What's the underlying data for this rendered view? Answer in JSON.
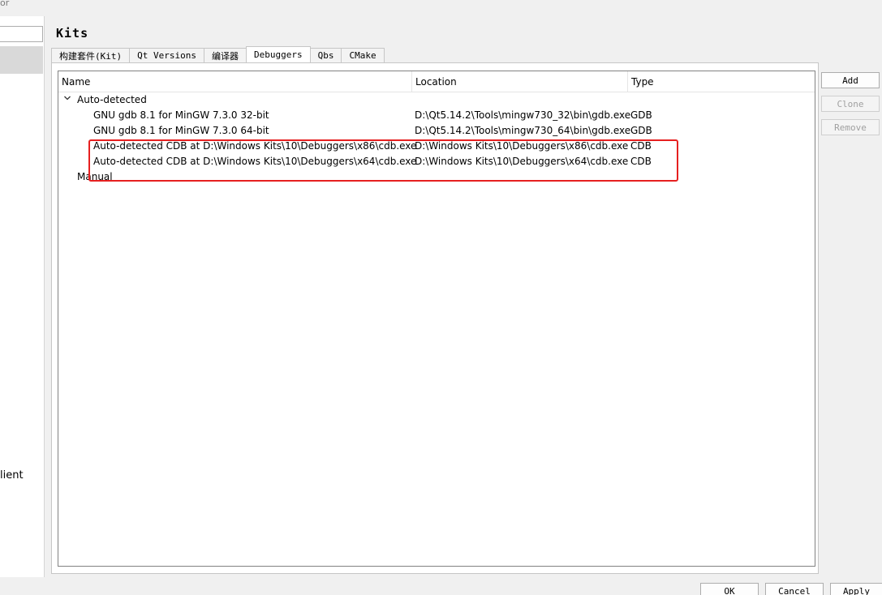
{
  "window": {
    "title_fragment": "or"
  },
  "left_pane": {
    "partial_item": "lient"
  },
  "page": {
    "title": "Kits"
  },
  "tabs": [
    {
      "label": "构建套件(Kit)",
      "active": false
    },
    {
      "label": "Qt Versions",
      "active": false
    },
    {
      "label": "编译器",
      "active": false
    },
    {
      "label": "Debuggers",
      "active": true
    },
    {
      "label": "Qbs",
      "active": false
    },
    {
      "label": "CMake",
      "active": false
    }
  ],
  "tree": {
    "columns": [
      "Name",
      "Location",
      "Type"
    ],
    "groups": [
      {
        "label": "Auto-detected",
        "expanded": true,
        "items": [
          {
            "name": "GNU gdb 8.1 for MinGW 7.3.0 32-bit",
            "location": "D:\\Qt5.14.2\\Tools\\mingw730_32\\bin\\gdb.exe",
            "type": "GDB"
          },
          {
            "name": "GNU gdb 8.1 for MinGW 7.3.0 64-bit",
            "location": "D:\\Qt5.14.2\\Tools\\mingw730_64\\bin\\gdb.exe",
            "type": "GDB"
          },
          {
            "name": "Auto-detected CDB at D:\\Windows Kits\\10\\Debuggers\\x86\\cdb.exe",
            "location": "D:\\Windows Kits\\10\\Debuggers\\x86\\cdb.exe",
            "type": "CDB"
          },
          {
            "name": "Auto-detected CDB at D:\\Windows Kits\\10\\Debuggers\\x64\\cdb.exe",
            "location": "D:\\Windows Kits\\10\\Debuggers\\x64\\cdb.exe",
            "type": "CDB"
          }
        ]
      },
      {
        "label": "Manual",
        "expanded": false,
        "items": []
      }
    ]
  },
  "side_buttons": {
    "add": "Add",
    "clone": "Clone",
    "remove": "Remove"
  },
  "dialog_buttons": {
    "ok": "OK",
    "cancel": "Cancel",
    "apply": "Apply"
  },
  "colors": {
    "highlight": "#e62020",
    "selection": "#d9d9d9"
  }
}
